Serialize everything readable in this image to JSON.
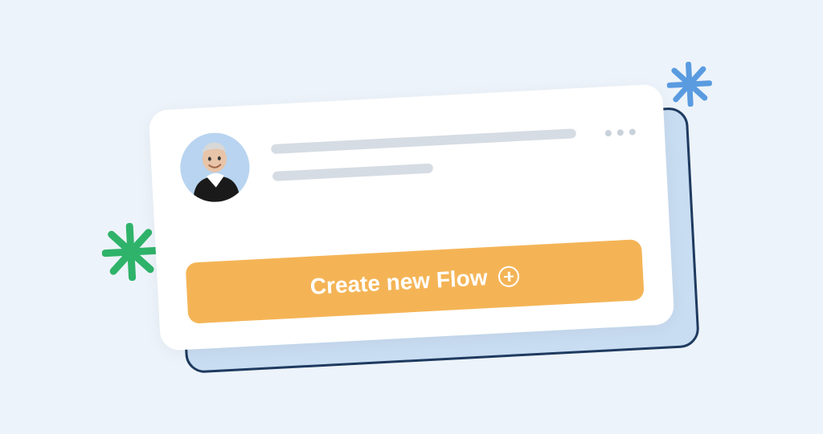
{
  "card": {
    "cta_label": "Create new Flow",
    "icons": {
      "cta": "plus-circle-icon",
      "more": "more-horizontal-icon"
    }
  },
  "decorations": {
    "sparkle_green_color": "#2fb36a",
    "sparkle_blue_color": "#5a9be0"
  }
}
